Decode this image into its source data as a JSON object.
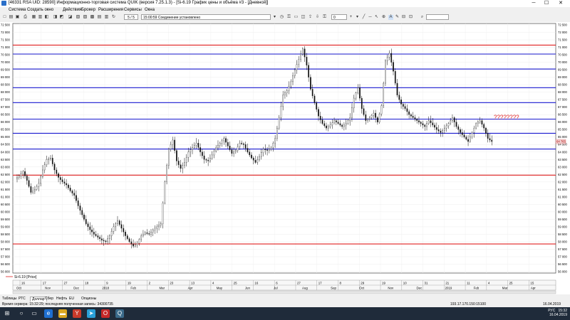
{
  "window": {
    "title": "[46331  RSA UID: 28590] Информационно-торговая система QUIK (версия 7.25.1.3) - [Si-6.19 График цены и объёма #3 - [Дневной]]",
    "min": "─",
    "max": "☐",
    "close": "✕"
  },
  "menu": [
    "Система",
    "Создать окно",
    "Действия",
    "Брокер",
    "Расширения",
    "Сервисы",
    "Окна"
  ],
  "toolbar": {
    "zoom": "5 / 5",
    "connection": "15:00:59 Соединение установлено",
    "interval": "0",
    "search_value": ""
  },
  "chart_data": {
    "type": "candlestick",
    "instrument_label": "Si-6.19 [Price]",
    "last_price_badge": "64 765",
    "annotation": "????????",
    "ylim": [
      56000,
      72500
    ],
    "y_ticks": [
      "72 500",
      "72 000",
      "71 500",
      "71 000",
      "70 500",
      "70 000",
      "69 500",
      "69 000",
      "68 500",
      "68 000",
      "67 500",
      "67 000",
      "66 500",
      "66 000",
      "65 500",
      "65 000",
      "64 500",
      "64 000",
      "63 500",
      "63 000",
      "62 500",
      "62 000",
      "61 500",
      "61 000",
      "60 500",
      "60 000",
      "59 500",
      "59 000",
      "58 500",
      "58 000",
      "57 500",
      "57 000",
      "56 500",
      "56 000"
    ],
    "x_day_ticks": [
      "16",
      "17",
      "27",
      "18",
      "9",
      "19",
      "2",
      "23",
      "13",
      "4",
      "25",
      "16",
      "6",
      "27",
      "17",
      "8",
      "29",
      "19",
      "10",
      "31",
      "21",
      "11",
      "4",
      "25",
      "15"
    ],
    "x_month_ticks": [
      "Oct",
      "Nov",
      "Dec",
      "2018",
      "Feb",
      "Mar",
      "Apr",
      "May",
      "Jun",
      "Jul",
      "Aug",
      "Sep",
      "Oct",
      "Nov",
      "Dec",
      "2019",
      "Feb",
      "Mar",
      "Apr"
    ],
    "horizontal_levels": [
      {
        "price": 71150,
        "color": "#e02020"
      },
      {
        "price": 70550,
        "color": "#1a1ad0"
      },
      {
        "price": 69550,
        "color": "#1a1ad0"
      },
      {
        "price": 68300,
        "color": "#1a1ad0"
      },
      {
        "price": 67300,
        "color": "#1a1ad0"
      },
      {
        "price": 66200,
        "color": "#1a1ad0"
      },
      {
        "price": 65250,
        "color": "#1a1ad0"
      },
      {
        "price": 64200,
        "color": "#1a1ad0"
      },
      {
        "price": 62450,
        "color": "#e02020"
      },
      {
        "price": 57850,
        "color": "#e02020"
      }
    ],
    "price_path": [
      62200,
      62400,
      62700,
      62100,
      61300,
      61500,
      61900,
      62800,
      63500,
      63600,
      62800,
      62300,
      62000,
      61800,
      61400,
      61100,
      60400,
      59800,
      59200,
      58800,
      58500,
      58300,
      58100,
      58000,
      58400,
      59000,
      59400,
      58900,
      58400,
      58000,
      57700,
      57900,
      58400,
      58600,
      58500,
      58800,
      59000,
      59200,
      62000,
      64200,
      64800,
      63400,
      62900,
      63300,
      64000,
      64300,
      64600,
      64000,
      63500,
      63400,
      63800,
      64300,
      64600,
      64900,
      64400,
      63900,
      64100,
      64600,
      64500,
      64000,
      63600,
      63300,
      63700,
      64200,
      64100,
      64300,
      64900,
      66300,
      67800,
      68100,
      68700,
      69500,
      70200,
      70900,
      69800,
      68200,
      67300,
      66400,
      65900,
      65600,
      65800,
      66100,
      65900,
      65700,
      65900,
      66300,
      67600,
      68300,
      66900,
      66100,
      66300,
      66600,
      66000,
      67100,
      70100,
      70600,
      69400,
      67800,
      67200,
      66900,
      66500,
      66300,
      66100,
      65900,
      65700,
      66100,
      65800,
      65500,
      65300,
      65600,
      65900,
      66300,
      65700,
      65300,
      65000,
      64700,
      65300,
      65900,
      66100,
      65600,
      64900,
      64700
    ]
  },
  "tabs": [
    "Таблицы",
    "РТС",
    "Доллар",
    "Сбер",
    "Нефть",
    "EU",
    "Опционы"
  ],
  "status": {
    "server_time": "Время сервера: 15:32:29; последняя полученная запись: 34300735",
    "ip": "193.17.170.150:15100",
    "date": "16.04.2019"
  },
  "taskbar": {
    "time": "15:32",
    "date": "16.04.2019",
    "lang": "РУС"
  }
}
